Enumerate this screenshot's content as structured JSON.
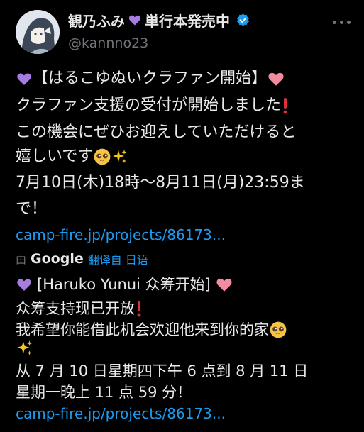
{
  "tweet": {
    "author_name": "観乃ふみ",
    "author_status": "単行本発売中",
    "handle": "@kannno23",
    "original_lines": [
      "【はるこゆぬいクラファン開始】",
      "クラファン支援の受付が開始しました",
      "この機会にぜひお迎えしていただけると",
      "嬉しいです",
      "7月10日(木)18時〜8月11日(月)23:59ま",
      "で！"
    ],
    "link": "camp-fire.jp/projects/86173..."
  },
  "translation": {
    "by_label": "由",
    "provider": "Google",
    "from_label": "翻译自 日语",
    "lines": [
      "[Haruko Yunui 众筹开始]",
      "众筹支持现已开放",
      "我希望你能借此机会欢迎他来到你的家",
      "从 7 月 10 日星期四下午 6 点到 8 月 11 日",
      "星期一晚上 11 点 59 分！"
    ],
    "link": "camp-fire.jp/projects/86173..."
  },
  "icons": {
    "heart_purple": "#a77ce0",
    "heart_pink": "#f08ca0",
    "verified": "#1d9bf0",
    "exclamation": "#e0303a"
  }
}
